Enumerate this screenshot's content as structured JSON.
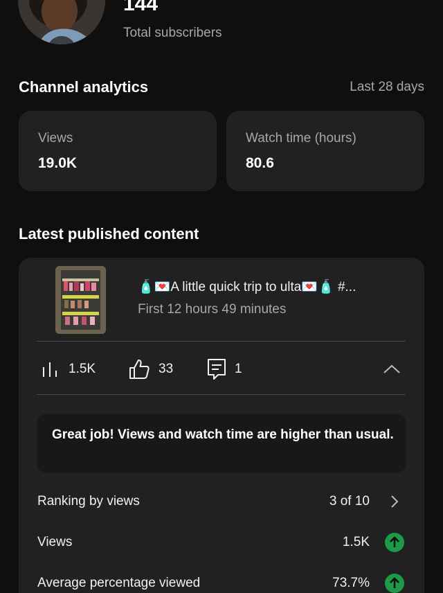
{
  "header": {
    "subscriber_count": "144",
    "subscriber_label": "Total subscribers"
  },
  "analytics": {
    "title": "Channel analytics",
    "period": "Last 28 days",
    "cards": [
      {
        "label": "Views",
        "value": "19.0K"
      },
      {
        "label": "Watch time (hours)",
        "value": "80.6"
      }
    ]
  },
  "latest": {
    "title": "Latest published content",
    "video": {
      "title": "🧴💌A little quick trip to ulta💌🧴 #...",
      "subtitle": "First 12 hours 49 minutes"
    },
    "stats": {
      "views": "1.5K",
      "likes": "33",
      "comments": "1"
    },
    "notice": "Great job! Views and watch time are higher than usual.",
    "rows": [
      {
        "label": "Ranking by views",
        "value": "3 of 10"
      },
      {
        "label": "Views",
        "value": "1.5K"
      },
      {
        "label": "Average percentage viewed",
        "value": "73.7%"
      }
    ]
  },
  "colors": {
    "background": "#0f0f0f",
    "card": "#212121",
    "positive": "#1c9a47",
    "secondary_text": "#a8a8a8"
  }
}
